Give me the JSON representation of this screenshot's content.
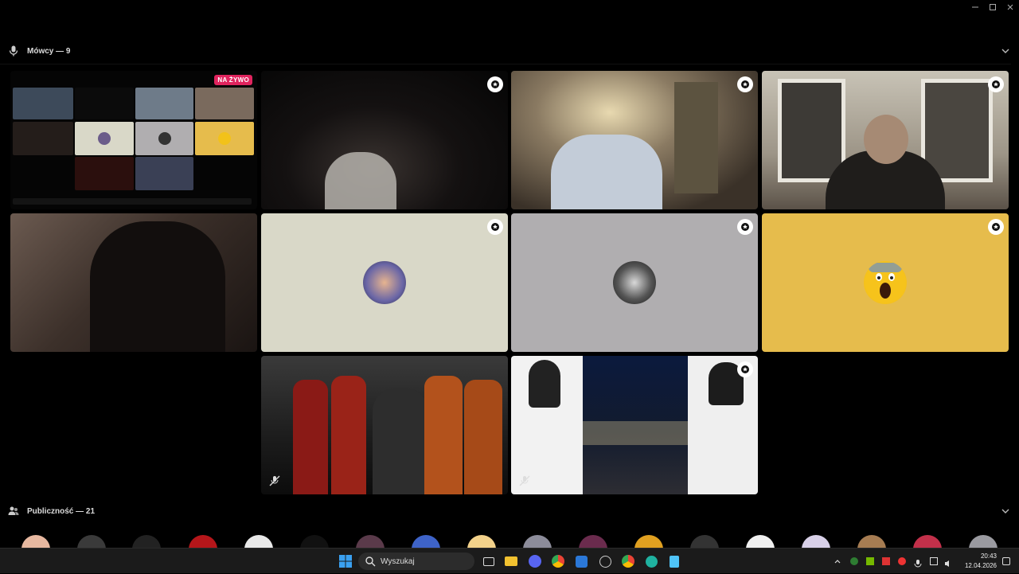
{
  "speakers": {
    "title": "Mówcy — 9"
  },
  "live_badge": "NA ŻYWO",
  "audience": {
    "title": "Publiczność — 21"
  },
  "taskbar": {
    "search_placeholder": "Wyszukaj",
    "clock_time": "20:43",
    "clock_date": "12.04.2026"
  },
  "colors": {
    "background": "#000000",
    "live_badge": "#e0245e",
    "tile_beige": "#d9d8c8",
    "tile_grey": "#b0aeb0",
    "tile_yellow": "#e6bc4c"
  },
  "icons": {
    "speakers": "microphone-icon",
    "audience": "people-icon",
    "collapse": "chevron-down-icon",
    "tile_badge": "star-badge-icon",
    "muted": "microphone-muted-icon"
  }
}
